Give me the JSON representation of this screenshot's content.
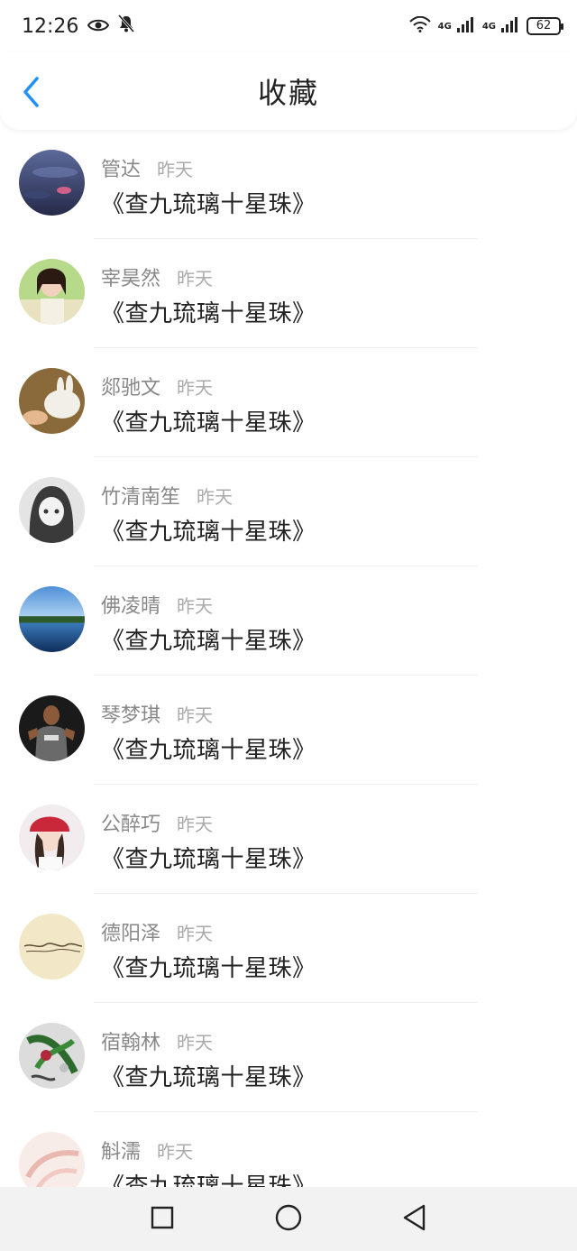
{
  "status_bar": {
    "time": "12:26",
    "battery": "62",
    "network_1": "4G",
    "network_2": "4G"
  },
  "header": {
    "title": "收藏",
    "back_icon": "chevron-left-icon",
    "accent_color": "#1e90ff"
  },
  "favorites": [
    {
      "name": "管达",
      "time": "昨天",
      "book": "《查九琉璃十星珠》"
    },
    {
      "name": "宰昊然",
      "time": "昨天",
      "book": "《查九琉璃十星珠》"
    },
    {
      "name": "郯驰文",
      "time": "昨天",
      "book": "《查九琉璃十星珠》"
    },
    {
      "name": "竹清南笙",
      "time": "昨天",
      "book": "《查九琉璃十星珠》"
    },
    {
      "name": "佛凌晴",
      "time": "昨天",
      "book": "《查九琉璃十星珠》"
    },
    {
      "name": "琴梦琪",
      "time": "昨天",
      "book": "《查九琉璃十星珠》"
    },
    {
      "name": "公醉巧",
      "time": "昨天",
      "book": "《查九琉璃十星珠》"
    },
    {
      "name": "德阳泽",
      "time": "昨天",
      "book": "《查九琉璃十星珠》"
    },
    {
      "name": "宿翰林",
      "time": "昨天",
      "book": "《查九琉璃十星珠》"
    },
    {
      "name": "斛濡",
      "time": "昨天",
      "book": "《查九琉璃十星珠》"
    }
  ],
  "nav_bar": {
    "icons": [
      "recents-square-icon",
      "home-circle-icon",
      "back-triangle-icon"
    ]
  }
}
